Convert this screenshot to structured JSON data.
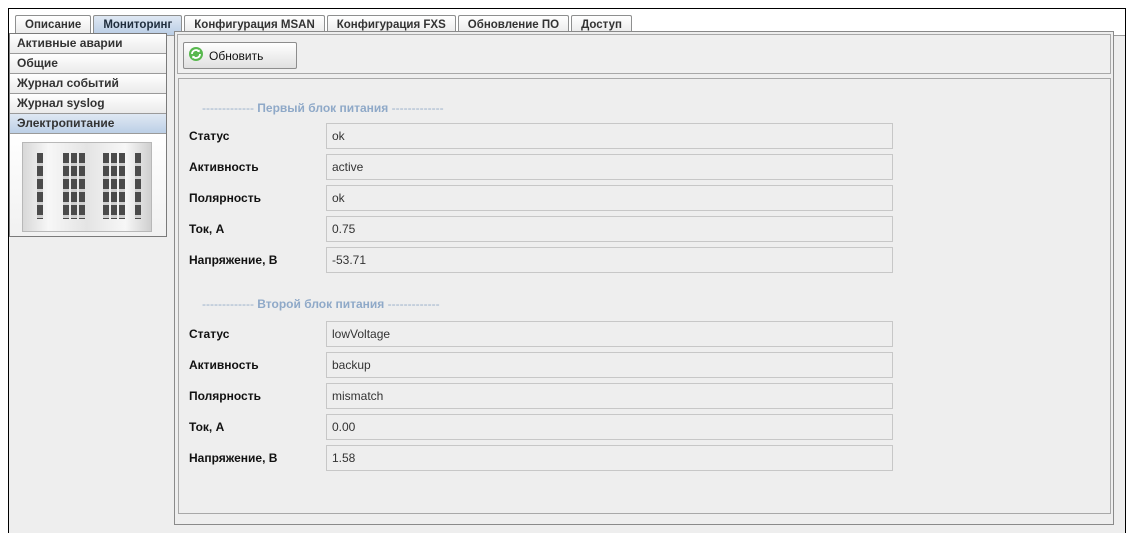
{
  "top_tabs": [
    {
      "label": "Описание",
      "active": false
    },
    {
      "label": "Мониторинг",
      "active": true
    },
    {
      "label": "Конфигурация MSAN",
      "active": false
    },
    {
      "label": "Конфигурация FXS",
      "active": false
    },
    {
      "label": "Обновление ПО",
      "active": false
    },
    {
      "label": "Доступ",
      "active": false
    }
  ],
  "side_tabs": [
    {
      "label": "Активные аварии",
      "active": false
    },
    {
      "label": "Общие",
      "active": false
    },
    {
      "label": "Журнал событий",
      "active": false
    },
    {
      "label": "Журнал syslog",
      "active": false
    },
    {
      "label": "Электропитание",
      "active": true
    }
  ],
  "toolbar": {
    "refresh_label": "Обновить",
    "refresh_icon": "refresh-icon"
  },
  "sections": [
    {
      "title": "Первый блок питания",
      "dashes": "-------------",
      "rows": [
        {
          "label": "Статус",
          "value": "ok"
        },
        {
          "label": "Активность",
          "value": "active"
        },
        {
          "label": "Полярность",
          "value": "ok"
        },
        {
          "label": "Ток, А",
          "value": "0.75"
        },
        {
          "label": "Напряжение, В",
          "value": "-53.71"
        }
      ]
    },
    {
      "title": "Второй блок питания",
      "dashes": "-------------",
      "rows": [
        {
          "label": "Статус",
          "value": "lowVoltage"
        },
        {
          "label": "Активность",
          "value": "backup"
        },
        {
          "label": "Полярность",
          "value": "mismatch"
        },
        {
          "label": "Ток, А",
          "value": "0.00"
        },
        {
          "label": "Напряжение, В",
          "value": "1.58"
        }
      ]
    }
  ],
  "colors": {
    "accent": "#bccfe6",
    "section_title": "#8fa9c8",
    "refresh_icon": "#3ea63a"
  }
}
